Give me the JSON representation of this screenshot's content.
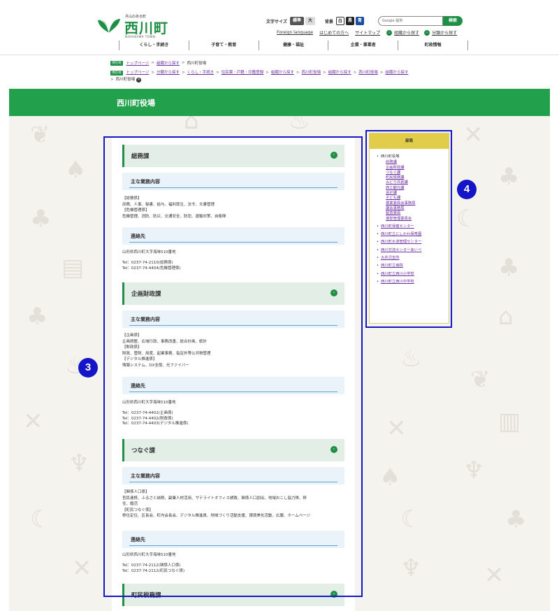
{
  "header": {
    "logo_small": "月山のある町",
    "logo_big": "西川町",
    "logo_roman": "NISHIKAWA TOWN",
    "font_size_label": "文字サイズ",
    "font_std": "標準",
    "font_large": "大",
    "bg_label": "背景",
    "bg_white": "白",
    "bg_black": "黒",
    "bg_blue": "青",
    "search_placeholder": "Google 提供",
    "search_button": "検索",
    "links": [
      "Foreign language",
      "はじめての方へ",
      "サイトマップ"
    ],
    "find_org": "組織から探す",
    "find_cat": "分類から探す",
    "gnav": [
      "くらし・手続き",
      "子育て・教育",
      "健康・福祉",
      "企業・事業者",
      "町政情報"
    ]
  },
  "breadcrumb1": {
    "tag": "現在地",
    "items": [
      "トップページ",
      "組織から探す"
    ],
    "current": "西川町役場"
  },
  "breadcrumb2": {
    "tag": "現在地",
    "items": [
      "トップページ",
      "分類から探す",
      "くらし・手続き",
      "住民票・戸籍・印鑑登録",
      "組織から探す",
      "西川町役場",
      "組織から探す",
      "西川町役場",
      "組織から探す"
    ],
    "current": "西川町役場"
  },
  "page_title": "西川町役場",
  "sections": [
    {
      "title": "総務課",
      "duties_label": "主な業務内容",
      "duties": "【総務係】\n庶務、人事、秘書、給与、福利厚生、法令、文書管理\n【危機管理係】\n危機管理、消防、防災、交通安全、防犯、運輸対策、自衛隊",
      "contact_label": "連絡先",
      "contact": "山形県西川町大字海味510番地\n\nTel：0237-74-2110(総務係)\nTel：0237-74-4404(危機管理係)"
    },
    {
      "title": "企画財政課",
      "duties_label": "主な業務内容",
      "duties": "【企画係】\n企画調整、広域行政、事務改善、総合計画、統計\n【財政係】\n財政、管財、用度、起業事務、指定外等公共物管理\n【デジタル推進係】\n情報システム、DX全般、光ファイバー",
      "contact_label": "連絡先",
      "contact": "山形県西川町大字海味510番地\n\nTel：0237-74-4402(企画係)\nTel：0237-74-4402(財政係)\nTel：0237-74-4403(デジタル推進係)"
    },
    {
      "title": "つなぐ課",
      "duties_label": "主な業務内容",
      "duties": "【関係人口係】\n官民連携、ふるさと納税、副業人材活用、サテライトオフィス誘致、関係人口創出、地域おこし協力隊、移\n住、婚活\n【町民つなぐ係】\n移住定住、区長会、町内会長会、デジタル推進員、地域づくり活動支援、環境美化活動、広聴、ホームページ",
      "contact_label": "連絡先",
      "contact": "山形県西川町大字海味510番地\n\nTel：0237-74-2112(関係人口係)\nTel：0237-74-2112(町民つなぐ係)"
    },
    {
      "title": "町民税務課"
    }
  ],
  "sidebar": {
    "heading": "部局",
    "office": "西川町役場",
    "departments": [
      "総務課",
      "企画財政課",
      "つなぐ課",
      "町民税務課",
      "みどり共創課",
      "商工観光課",
      "会計課",
      "子ども課",
      "農業委員会事務局",
      "議会事務局",
      "監査委員",
      "選挙管理委員会"
    ],
    "facilities": [
      "西川町保健センター",
      "西川町立にしかわ保育園",
      "西川町水道管理センター",
      "西川交流センターあいべ",
      "大井沢支所",
      "西川町立病院",
      "西川町立西川小学校",
      "西川町立西川中学校"
    ]
  },
  "annotations": {
    "box3_label": "3",
    "box4_label": "4",
    "color": "#1515c8"
  },
  "colors": {
    "brand_green": "#1f8f45",
    "title_bar": "#22a04b",
    "section_bg": "#e3efe6",
    "subsection_bg": "#eaf3f9",
    "sidebar_head": "#e2cd4b"
  }
}
